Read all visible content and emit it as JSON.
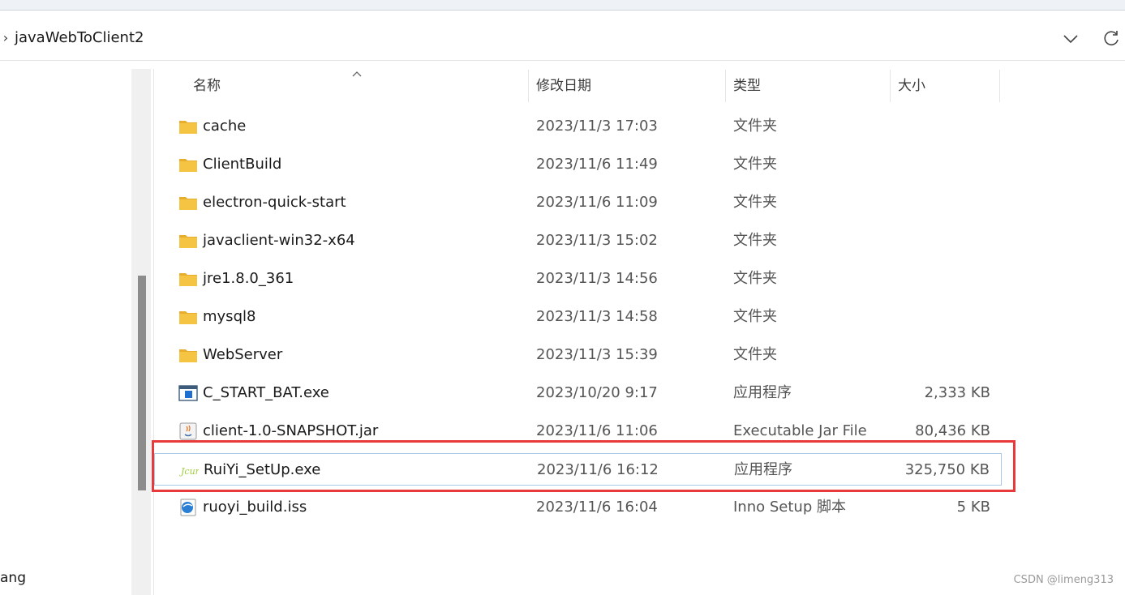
{
  "address": {
    "path": "javaWebToClient2"
  },
  "nav": {
    "fragment_text": "ang"
  },
  "columns": {
    "name": "名称",
    "date": "修改日期",
    "type": "类型",
    "size": "大小"
  },
  "files": [
    {
      "name": "cache",
      "date": "2023/11/3 17:03",
      "type": "文件夹",
      "size": "",
      "icon": "folder-icon"
    },
    {
      "name": "ClientBuild",
      "date": "2023/11/6 11:49",
      "type": "文件夹",
      "size": "",
      "icon": "folder-icon"
    },
    {
      "name": "electron-quick-start",
      "date": "2023/11/6 11:09",
      "type": "文件夹",
      "size": "",
      "icon": "folder-icon"
    },
    {
      "name": "javaclient-win32-x64",
      "date": "2023/11/3 15:02",
      "type": "文件夹",
      "size": "",
      "icon": "folder-icon"
    },
    {
      "name": "jre1.8.0_361",
      "date": "2023/11/3 14:56",
      "type": "文件夹",
      "size": "",
      "icon": "folder-icon"
    },
    {
      "name": "mysql8",
      "date": "2023/11/3 14:58",
      "type": "文件夹",
      "size": "",
      "icon": "folder-icon"
    },
    {
      "name": "WebServer",
      "date": "2023/11/3 15:39",
      "type": "文件夹",
      "size": "",
      "icon": "folder-icon"
    },
    {
      "name": "C_START_BAT.exe",
      "date": "2023/10/20 9:17",
      "type": "应用程序",
      "size": "2,333 KB",
      "icon": "exe-window-icon"
    },
    {
      "name": "client-1.0-SNAPSHOT.jar",
      "date": "2023/11/6 11:06",
      "type": "Executable Jar File",
      "size": "80,436 KB",
      "icon": "java-jar-icon"
    },
    {
      "name": "RuiYi_SetUp.exe",
      "date": "2023/11/6 16:12",
      "type": "应用程序",
      "size": "325,750 KB",
      "icon": "installer-icon"
    },
    {
      "name": "ruoyi_build.iss",
      "date": "2023/11/6 16:04",
      "type": "Inno Setup 脚本",
      "size": "5 KB",
      "icon": "inno-setup-icon"
    }
  ],
  "watermark": "CSDN @limeng313",
  "colors": {
    "folder": "#f6c443",
    "highlight": "#e8393b",
    "selection_border": "#a8c8e8"
  }
}
